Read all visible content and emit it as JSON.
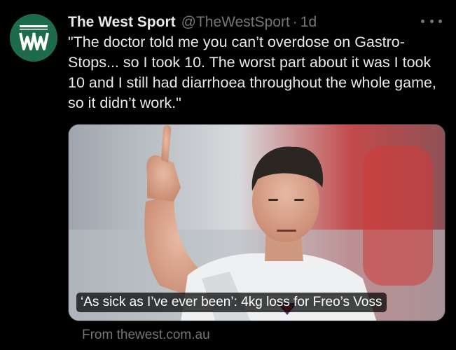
{
  "tweet": {
    "display_name": "The West Sport",
    "handle": "@TheWestSport",
    "separator": "·",
    "time": "1d",
    "text": "\"The doctor told me you can’t overdose on Gastro-Stops... so I took 10. The worst part about it was I took 10 and I still had diarrhoea throughout the whole game, so it didn’t work.\"",
    "avatar_icon": "the-west-logo-icon",
    "more_icon": "more-options-icon"
  },
  "card": {
    "caption": "‘As sick as I’ve ever been’: 4kg loss for Freo’s Voss",
    "source": "From thewest.com.au",
    "image_desc": "player-thumbs-up-photo"
  },
  "colors": {
    "background": "#000000",
    "avatar_bg": "#1d6b4b",
    "primary_text": "#e7e9ea",
    "secondary_text": "#71767b"
  }
}
